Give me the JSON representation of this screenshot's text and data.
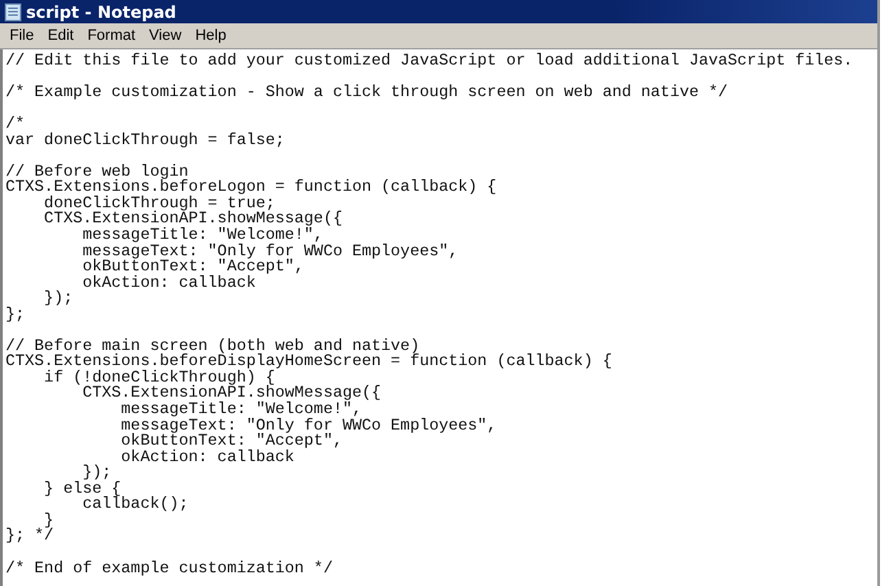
{
  "window": {
    "title": "script - Notepad"
  },
  "menu": [
    "File",
    "Edit",
    "Format",
    "View",
    "Help"
  ],
  "editor": {
    "blocks": [
      [
        "// Edit this file to add your customized JavaScript or load additional JavaScript files."
      ],
      [
        "/* Example customization - Show a click through screen on web and native */"
      ],
      [
        "/*",
        "var doneClickThrough = false;"
      ],
      [
        "// Before web login",
        "CTXS.Extensions.beforeLogon = function (callback) {",
        "    doneClickThrough = true;",
        "    CTXS.ExtensionAPI.showMessage({",
        "        messageTitle: \"Welcome!\",",
        "        messageText: \"Only for WWCo Employees\",",
        "        okButtonText: \"Accept\",",
        "        okAction: callback",
        "    });",
        "};"
      ],
      [
        "// Before main screen (both web and native)",
        "CTXS.Extensions.beforeDisplayHomeScreen = function (callback) {",
        "    if (!doneClickThrough) {",
        "        CTXS.ExtensionAPI.showMessage({",
        "            messageTitle: \"Welcome!\",",
        "            messageText: \"Only for WWCo Employees\",",
        "            okButtonText: \"Accept\",",
        "            okAction: callback",
        "        });",
        "    } else {",
        "        callback();",
        "    }",
        "}; */"
      ],
      [
        "/* End of example customization */"
      ]
    ]
  }
}
